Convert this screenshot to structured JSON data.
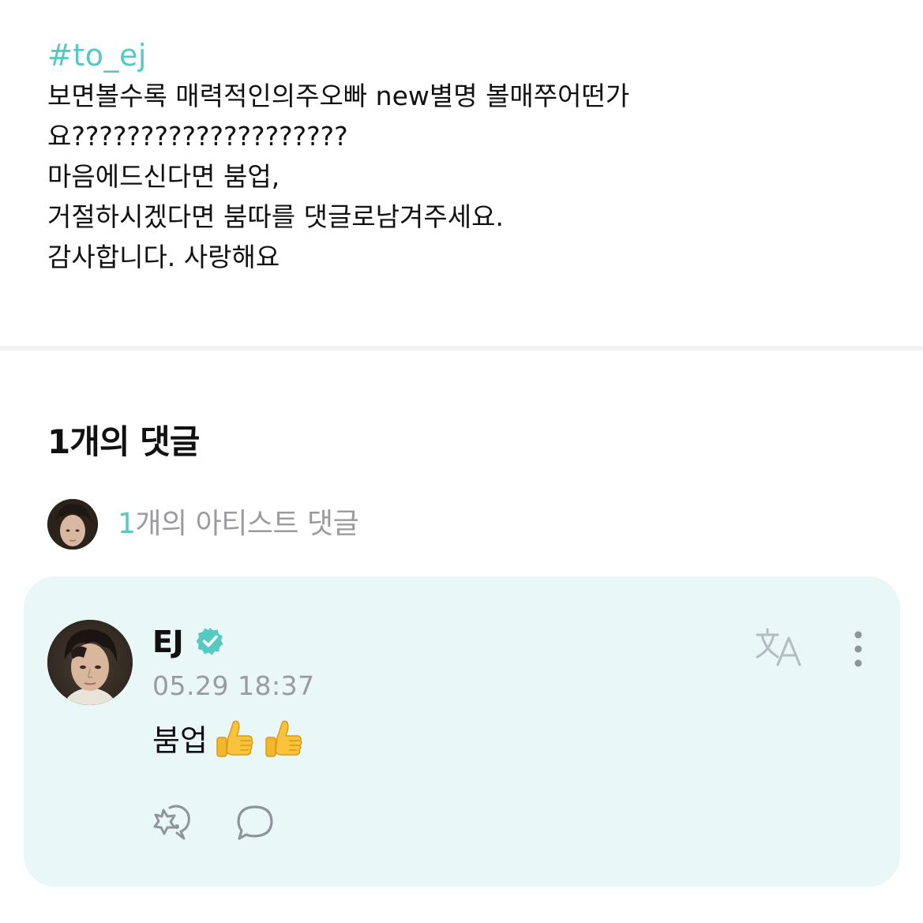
{
  "post": {
    "hashtag": "#to_ej",
    "lines": [
      "보면볼수록 매력적인의주오빠 new별명 볼매쭈어떤가",
      "요????????????????????",
      "마음에드신다면 붐업,",
      "거절하시겠다면 붐따를 댓글로남겨주세요.",
      "감사합니다. 사랑해요"
    ]
  },
  "comments_section": {
    "title": "1개의 댓글",
    "artist_count": "1",
    "artist_label": "개의 아티스트 댓글"
  },
  "comment": {
    "author": "EJ",
    "verified": true,
    "timestamp": "05.29 18:37",
    "text": "붐업",
    "emoji_count": 2,
    "emoji_name": "thumbs-up"
  },
  "icons": {
    "translate": "translate-icon",
    "more": "more-vertical-icon",
    "reaction": "reaction-icon",
    "reply": "reply-bubble-icon",
    "verified": "verified-badge-icon"
  },
  "colors": {
    "accent": "#56c9c2",
    "card_background": "#e9f8f6",
    "muted_text": "#9a9a9f",
    "icon_gray": "#8e9497"
  }
}
